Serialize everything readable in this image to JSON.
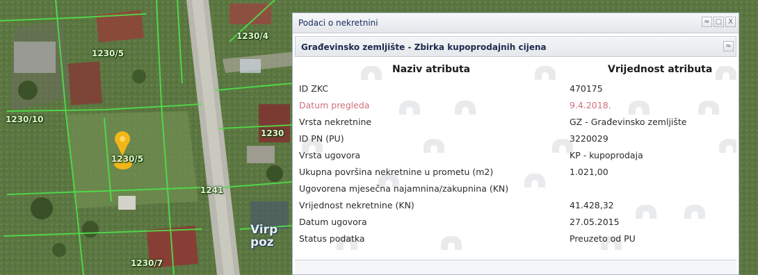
{
  "map": {
    "parcel_labels": [
      "1230/5",
      "1230/4",
      "1230/10",
      "1230",
      "1230/5",
      "1241",
      "1230/7"
    ],
    "side_text_1": "Virp",
    "side_text_2": "poz"
  },
  "window": {
    "title": "Podaci o nekretnini",
    "buttons": {
      "collapse": "≈",
      "maximize": "□",
      "close": "X"
    }
  },
  "panel": {
    "title": "Građevinsko zemljište - Zbirka kupoprodajnih cijena",
    "collapse_icon": "≈"
  },
  "attributes": {
    "header_name": "Naziv atributa",
    "header_value": "Vrijednost atributa",
    "rows": [
      {
        "name": "ID ZKC",
        "value": "470175"
      },
      {
        "name": "Datum pregleda",
        "value": "9.4.2018."
      },
      {
        "name": "Vrsta nekretnine",
        "value": "GZ - Građevinsko zemljište"
      },
      {
        "name": "ID PN (PU)",
        "value": "3220029"
      },
      {
        "name": "Vrsta ugovora",
        "value": "KP - kupoprodaja"
      },
      {
        "name": "Ukupna površina nekretnine u prometu (m2)",
        "value": "1.021,00"
      },
      {
        "name": "Ugovorena mjesečna najamnina/zakupnina (KN)",
        "value": ""
      },
      {
        "name": "Vrijednost nekretnine (KN)",
        "value": "41.428,32"
      },
      {
        "name": "Datum ugovora",
        "value": "27.05.2015"
      },
      {
        "name": "Status podatka",
        "value": "Preuzeto od PU"
      }
    ]
  },
  "colors": {
    "highlight_row": "#cf6f7a",
    "marker": "#f2b619",
    "parcel_lines": "#4fe04a"
  }
}
